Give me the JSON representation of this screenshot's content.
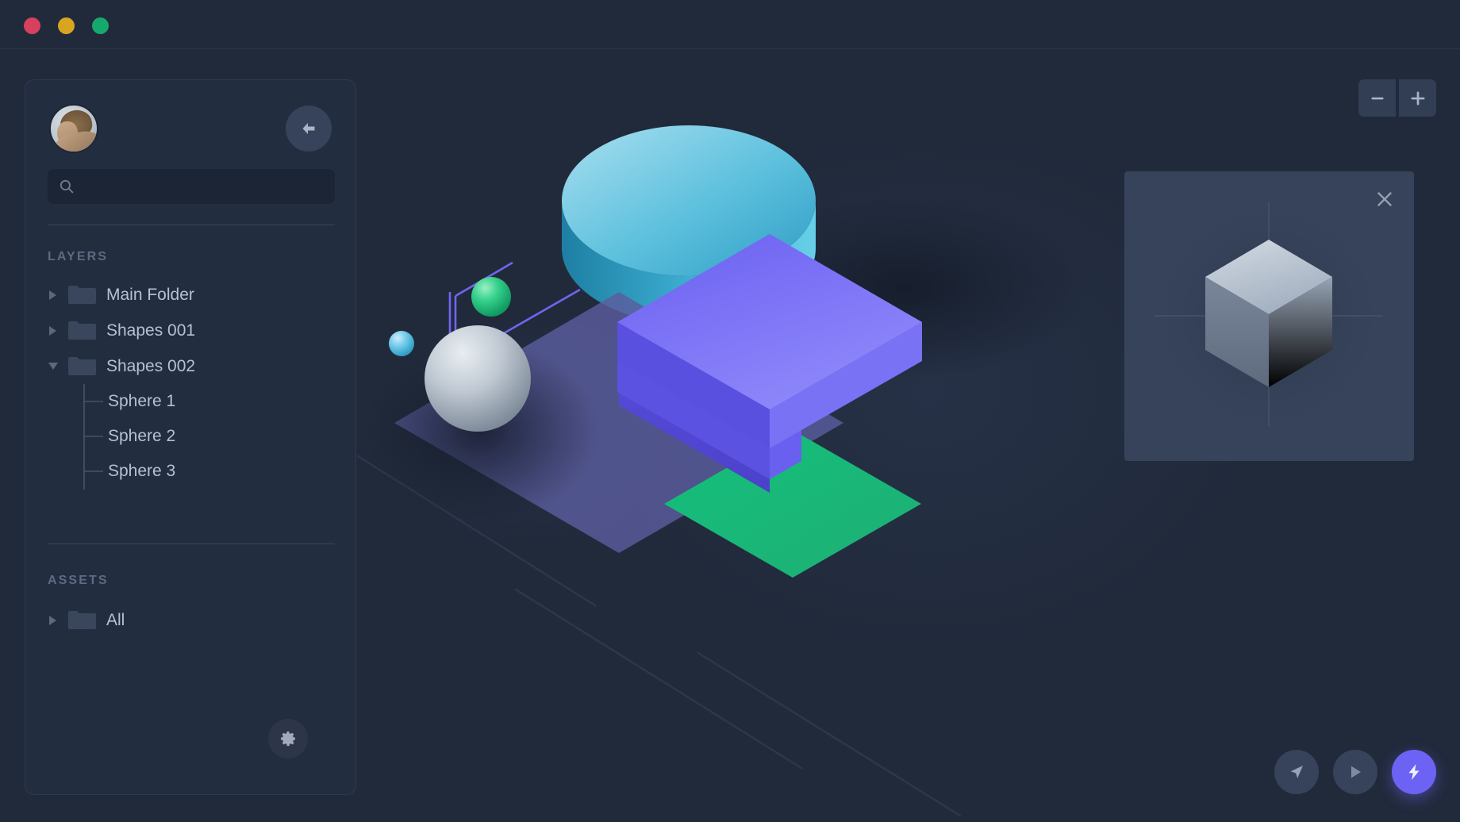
{
  "window": {
    "traffic_lights": [
      {
        "name": "close",
        "color": "#d8415e"
      },
      {
        "name": "minimize",
        "color": "#d9a520"
      },
      {
        "name": "maximize",
        "color": "#16a96d"
      }
    ]
  },
  "sidebar": {
    "avatar_alt": "User avatar",
    "back_button": "back-arrow-icon",
    "search": {
      "value": "",
      "placeholder": "",
      "icon": "search-icon"
    },
    "sections": [
      {
        "title": "LAYERS",
        "items": [
          {
            "label": "Main Folder",
            "icon": "folder-icon",
            "expanded": false,
            "caret": "chevron-right-icon"
          },
          {
            "label": "Shapes 001",
            "icon": "folder-icon",
            "expanded": false,
            "caret": "chevron-right-icon"
          },
          {
            "label": "Shapes 002",
            "icon": "folder-icon",
            "expanded": true,
            "caret": "chevron-down-icon",
            "children": [
              {
                "label": "Sphere 1"
              },
              {
                "label": "Sphere 2"
              },
              {
                "label": "Sphere 3"
              }
            ]
          }
        ]
      },
      {
        "title": "ASSETS",
        "items": [
          {
            "label": "All",
            "icon": "folder-icon",
            "expanded": false,
            "caret": "chevron-right-icon"
          }
        ]
      }
    ],
    "settings_button": "gear-icon"
  },
  "toolbar": {
    "zoom_out": "minus-icon",
    "zoom_in": "plus-icon"
  },
  "preview": {
    "close_button": "close-icon",
    "content": "isometric-cube"
  },
  "actions": [
    {
      "name": "navigate-button",
      "icon": "navigation-arrow-icon",
      "accent": false
    },
    {
      "name": "play-button",
      "icon": "play-icon",
      "accent": false
    },
    {
      "name": "boost-button",
      "icon": "lightning-bolt-icon",
      "accent": true
    }
  ],
  "colors": {
    "background": "#212a3b",
    "panel": "#232d40",
    "panel_light": "#36435a",
    "accent_purple": "#6c63f5",
    "accent_green": "#19b87a",
    "accent_cyan": "#5cc4de",
    "text_primary": "#b6c1d0",
    "text_muted": "#5d6a82"
  },
  "scene": {
    "objects": [
      {
        "name": "cylinder",
        "color": "#5cc4de"
      },
      {
        "name": "sphere-green",
        "color": "#2ecd8b"
      },
      {
        "name": "sphere-blue",
        "color": "#6ec9e8"
      },
      {
        "name": "sphere-gray",
        "color": "#c3cbd4"
      },
      {
        "name": "plane-translucent",
        "color": "#5c5fa0"
      },
      {
        "name": "slab-purple",
        "color": "#6c63f5"
      },
      {
        "name": "plane-green",
        "color": "#19b87a"
      }
    ]
  }
}
